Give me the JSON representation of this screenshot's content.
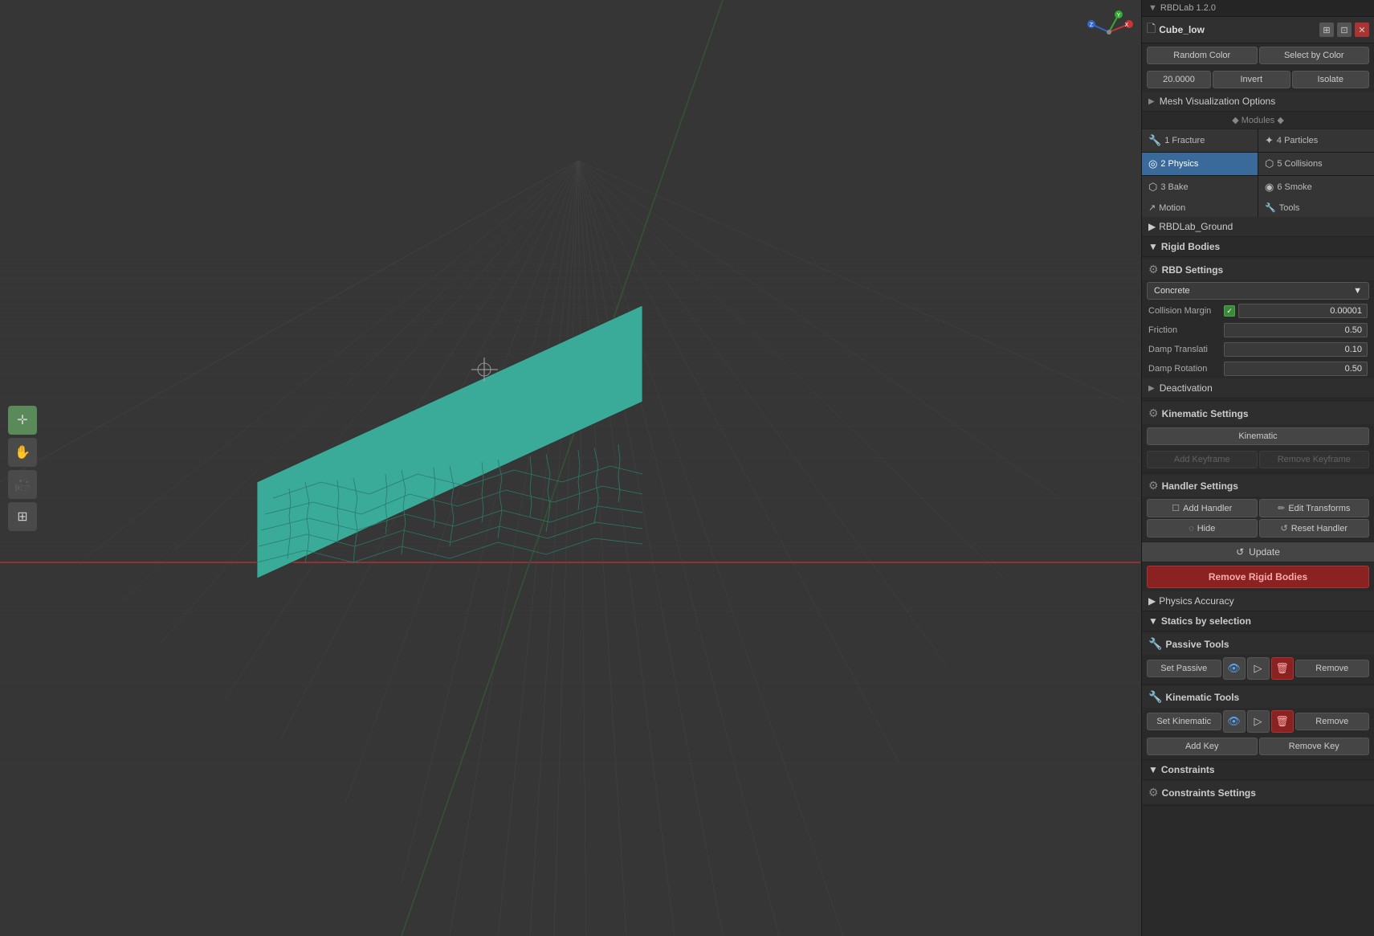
{
  "version": {
    "label": "RBDLab 1.2.0",
    "chevron": "▼"
  },
  "tab": {
    "icon": "🗋",
    "title": "Cube_low",
    "close": "✕",
    "expand": "⊞",
    "pin": "📌"
  },
  "buttons": {
    "random_color": "Random Color",
    "select_by_color": "Select by Color",
    "value_20": "20.0000",
    "invert": "Invert",
    "isolate": "Isolate"
  },
  "mesh_viz": {
    "label": "Mesh Visualization Options",
    "tri": "▶"
  },
  "modules_header": "◆ Modules ◆",
  "modules": [
    {
      "id": "fracture",
      "num": "1",
      "label": "Fracture",
      "icon": "🔧",
      "active": false
    },
    {
      "id": "particles",
      "num": "4",
      "label": "Particles",
      "icon": "✦",
      "active": false
    },
    {
      "id": "physics",
      "num": "2",
      "label": "Physics",
      "icon": "◎",
      "active": true
    },
    {
      "id": "collisions",
      "num": "5",
      "label": "Collisions",
      "icon": "⬡",
      "active": false
    },
    {
      "id": "bake",
      "num": "3",
      "label": "Bake",
      "icon": "⬡",
      "active": false
    },
    {
      "id": "smoke",
      "num": "6",
      "label": "Smoke",
      "icon": "◉",
      "active": false
    }
  ],
  "modules_bottom": [
    {
      "id": "motion",
      "label": "Motion",
      "icon": "↗"
    },
    {
      "id": "tools",
      "label": "Tools",
      "icon": "🔧"
    }
  ],
  "rbd_ground": {
    "label": "RBDLab_Ground",
    "tri": "▶"
  },
  "rigid_bodies": {
    "label": "Rigid Bodies",
    "tri": "▼"
  },
  "rbd_settings": {
    "label": "RBD Settings",
    "icon": "⚙",
    "preset": "Concrete",
    "collision_margin_label": "Collision Margin",
    "collision_margin_checked": true,
    "collision_margin_value": "0.00001",
    "friction_label": "Friction",
    "friction_value": "0.50",
    "damp_translati_label": "Damp Translati",
    "damp_translati_value": "0.10",
    "damp_rotation_label": "Damp Rotation",
    "damp_rotation_value": "0.50"
  },
  "deactivation": {
    "label": "Deactivation",
    "tri": "▶"
  },
  "kinematic_settings": {
    "label": "Kinematic Settings",
    "icon": "⚙",
    "kinematic_btn": "Kinematic",
    "add_keyframe": "Add Keyframe",
    "remove_keyframe": "Remove Keyframe"
  },
  "handler_settings": {
    "label": "Handler Settings",
    "icon": "⚙",
    "add_handler": "Add Handler",
    "edit_transforms": "Edit Transforms",
    "hide": "Hide",
    "reset_handler": "Reset Handler"
  },
  "update_btn": "Update",
  "remove_rigid_bodies": "Remove Rigid Bodies",
  "physics_accuracy": {
    "label": "Physics Accuracy",
    "tri": "▶"
  },
  "statics": {
    "label": "Statics by selection",
    "tri": "▼"
  },
  "passive_tools": {
    "label": "Passive Tools",
    "icon": "🔧",
    "set_passive": "Set Passive",
    "remove": "Remove"
  },
  "kinematic_tools": {
    "label": "Kinematic Tools",
    "icon": "🔧",
    "set_kinematic": "Set Kinematic",
    "remove": "Remove",
    "add_key": "Add Key",
    "remove_key": "Remove Key"
  },
  "constraints": {
    "label": "Constraints",
    "tri": "▼"
  },
  "constraints_settings": {
    "label": "Constraints Settings",
    "icon": "⚙"
  },
  "toolbar": {
    "tools": [
      "cursor",
      "move",
      "camera",
      "grid"
    ]
  }
}
